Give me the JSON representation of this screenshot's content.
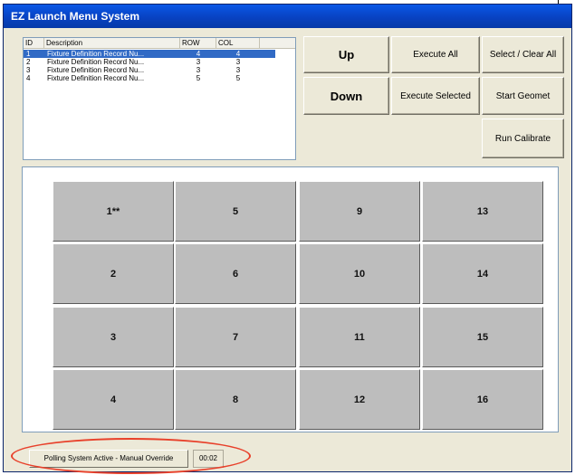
{
  "window": {
    "title": "EZ Launch Menu System"
  },
  "fixture_list": {
    "headers": [
      "ID",
      "Description",
      "ROW",
      "COL"
    ],
    "rows": [
      {
        "id": "1",
        "description": "Fixture Definition Record Nu...",
        "row": "4",
        "col": "4",
        "selected": true
      },
      {
        "id": "2",
        "description": "Fixture Definition Record Nu...",
        "row": "3",
        "col": "3",
        "selected": false
      },
      {
        "id": "3",
        "description": "Fixture Definition Record Nu...",
        "row": "3",
        "col": "3",
        "selected": false
      },
      {
        "id": "4",
        "description": "Fixture Definition Record Nu...",
        "row": "5",
        "col": "5",
        "selected": false
      }
    ]
  },
  "buttons": {
    "up": "Up",
    "down": "Down",
    "execute_all": "Execute All",
    "execute_selected": "Execute Selected",
    "select_clear_all": "Select / Clear All",
    "start_geomet": "Start Geomet",
    "run_calibrate": "Run Calibrate"
  },
  "grid": {
    "columns": [
      [
        "1**",
        "2",
        "3",
        "4"
      ],
      [
        "5",
        "6",
        "7",
        "8"
      ],
      [
        "9",
        "10",
        "11",
        "12"
      ],
      [
        "13",
        "14",
        "15",
        "16"
      ]
    ]
  },
  "status": {
    "mode": "Polling System Active - Manual Override",
    "timer": "00:02"
  },
  "colors": {
    "titlebar": "#0a58e6",
    "selection": "#316ac5",
    "cell": "#bdbdbd",
    "highlight": "#e8402a"
  }
}
